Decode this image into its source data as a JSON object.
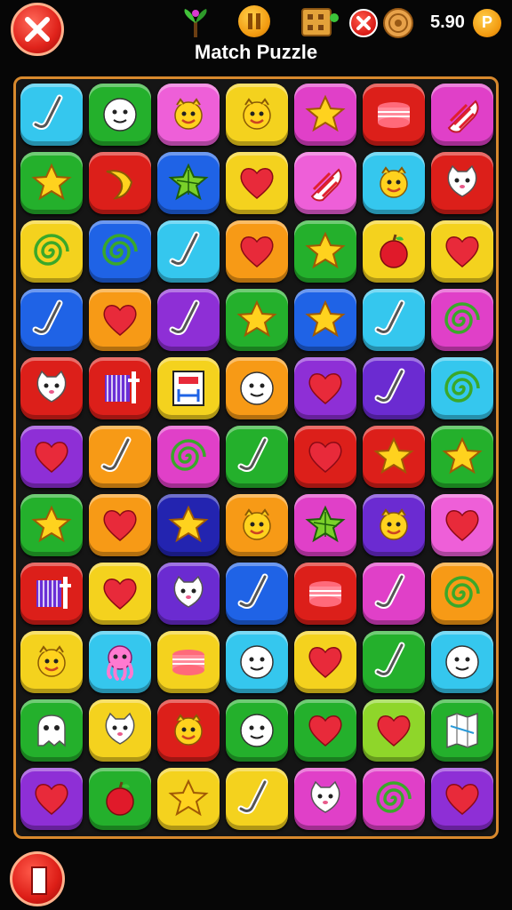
{
  "header": {
    "title": "Match Puzzle",
    "coins": "5.90",
    "coin_symbol": "P",
    "icons": [
      "close-icon",
      "plant-icon",
      "pause-icon",
      "crate-icon",
      "no-entry-icon",
      "cookie-icon",
      "coin-icon"
    ]
  },
  "colors": {
    "cyan": "#35c7ee",
    "green": "#24b02c",
    "pink": "#ee5fd8",
    "yellow": "#f4d21e",
    "orange": "#f79a16",
    "red": "#dc1f1a",
    "magenta": "#e040c8",
    "blue": "#1f63e6",
    "purple": "#8e2fd6",
    "lime": "#8fd62a",
    "darkblue": "#2324b0",
    "violet": "#6b2bd1",
    "board_border": "#d8892d"
  },
  "board": {
    "rows": 11,
    "cols": 7,
    "tiles": [
      [
        {
          "c": "cyan",
          "i": "hockey-stick"
        },
        {
          "c": "green",
          "i": "face"
        },
        {
          "c": "pink",
          "i": "sun-face"
        },
        {
          "c": "yellow",
          "i": "sun-face"
        },
        {
          "c": "magenta",
          "i": "star"
        },
        {
          "c": "red",
          "i": "cake"
        },
        {
          "c": "magenta",
          "i": "candy-stripe"
        }
      ],
      [
        {
          "c": "green",
          "i": "star"
        },
        {
          "c": "red",
          "i": "banana"
        },
        {
          "c": "blue",
          "i": "leaf-star"
        },
        {
          "c": "yellow",
          "i": "heart"
        },
        {
          "c": "pink",
          "i": "candy-stripe"
        },
        {
          "c": "cyan",
          "i": "sun-face"
        },
        {
          "c": "red",
          "i": "cat-face"
        }
      ],
      [
        {
          "c": "yellow",
          "i": "swirl"
        },
        {
          "c": "blue",
          "i": "swirl"
        },
        {
          "c": "cyan",
          "i": "hockey-stick"
        },
        {
          "c": "orange",
          "i": "heart"
        },
        {
          "c": "green",
          "i": "star"
        },
        {
          "c": "yellow",
          "i": "apple"
        },
        {
          "c": "yellow",
          "i": "heart"
        }
      ],
      [
        {
          "c": "blue",
          "i": "hockey-stick"
        },
        {
          "c": "orange",
          "i": "heart"
        },
        {
          "c": "purple",
          "i": "hockey-stick"
        },
        {
          "c": "green",
          "i": "star"
        },
        {
          "c": "blue",
          "i": "star"
        },
        {
          "c": "cyan",
          "i": "hockey-stick"
        },
        {
          "c": "magenta",
          "i": "swirl"
        }
      ],
      [
        {
          "c": "red",
          "i": "cat-face"
        },
        {
          "c": "red",
          "i": "rake"
        },
        {
          "c": "yellow",
          "i": "sign"
        },
        {
          "c": "orange",
          "i": "face"
        },
        {
          "c": "purple",
          "i": "heart"
        },
        {
          "c": "violet",
          "i": "hockey-stick"
        },
        {
          "c": "cyan",
          "i": "swirl"
        }
      ],
      [
        {
          "c": "purple",
          "i": "heart"
        },
        {
          "c": "orange",
          "i": "hockey-stick"
        },
        {
          "c": "magenta",
          "i": "swirl"
        },
        {
          "c": "green",
          "i": "hockey-stick"
        },
        {
          "c": "red",
          "i": "heart"
        },
        {
          "c": "red",
          "i": "star"
        },
        {
          "c": "green",
          "i": "star"
        }
      ],
      [
        {
          "c": "green",
          "i": "star"
        },
        {
          "c": "orange",
          "i": "heart"
        },
        {
          "c": "darkblue",
          "i": "star"
        },
        {
          "c": "orange",
          "i": "sun-face"
        },
        {
          "c": "magenta",
          "i": "leaf-star"
        },
        {
          "c": "violet",
          "i": "sun-face"
        },
        {
          "c": "pink",
          "i": "heart"
        }
      ],
      [
        {
          "c": "red",
          "i": "rake"
        },
        {
          "c": "yellow",
          "i": "heart"
        },
        {
          "c": "violet",
          "i": "cat-face"
        },
        {
          "c": "blue",
          "i": "hockey-stick"
        },
        {
          "c": "red",
          "i": "cake"
        },
        {
          "c": "magenta",
          "i": "hockey-stick"
        },
        {
          "c": "orange",
          "i": "swirl"
        }
      ],
      [
        {
          "c": "yellow",
          "i": "sun-face"
        },
        {
          "c": "cyan",
          "i": "octopus"
        },
        {
          "c": "yellow",
          "i": "cake"
        },
        {
          "c": "cyan",
          "i": "face"
        },
        {
          "c": "yellow",
          "i": "heart"
        },
        {
          "c": "green",
          "i": "hockey-stick"
        },
        {
          "c": "cyan",
          "i": "face"
        }
      ],
      [
        {
          "c": "green",
          "i": "ghost"
        },
        {
          "c": "yellow",
          "i": "cat-face"
        },
        {
          "c": "red",
          "i": "sun-face"
        },
        {
          "c": "green",
          "i": "face"
        },
        {
          "c": "green",
          "i": "heart"
        },
        {
          "c": "lime",
          "i": "heart"
        },
        {
          "c": "green",
          "i": "map"
        }
      ],
      [
        {
          "c": "purple",
          "i": "heart"
        },
        {
          "c": "green",
          "i": "apple"
        },
        {
          "c": "yellow",
          "i": "star"
        },
        {
          "c": "yellow",
          "i": "hockey-stick"
        },
        {
          "c": "magenta",
          "i": "cat-face"
        },
        {
          "c": "magenta",
          "i": "swirl"
        },
        {
          "c": "purple",
          "i": "heart"
        }
      ]
    ]
  }
}
